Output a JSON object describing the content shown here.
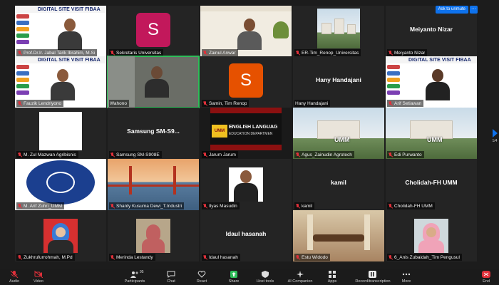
{
  "window": {
    "ask_to_unmute": "Ask to unmute",
    "more": "···",
    "page_indicator": "1/4"
  },
  "tiles": [
    {
      "name": "Prof.Dr.Ir. Jabal Tarik Ibrahim, M.Si",
      "slide_title": "DIGITAL SITE VISIT FIBAA"
    },
    {
      "name": "Sekretaris Universitas",
      "avatar": "S",
      "avatar_color": "#c2185b"
    },
    {
      "name": "Zainul Anwar"
    },
    {
      "name": "ER-Tim_Renop_Universitas"
    },
    {
      "name": "Meiyanto Nizar",
      "big": "Meiyanto Nizar"
    },
    {
      "name": "Fauzik Lendriyono",
      "slide_title": "DIGITAL SITE VISIT FIBAA"
    },
    {
      "name": "Wahono"
    },
    {
      "name": "Samin, Tim Renop",
      "avatar": "S",
      "avatar_color": "#e65100"
    },
    {
      "name": "Hany Handajani",
      "big": "Hany Handajani"
    },
    {
      "name": "Arif Setiawan",
      "slide_title": "DIGITAL SITE VISIT FIBAA"
    },
    {
      "name": "M. Zul Mazwan Agribisnis"
    },
    {
      "name": "Samsung SM-S908E",
      "big": "Samsung  SM-S9..."
    },
    {
      "name": "Jarum Jarum",
      "banner_line1": "ENGLISH LANGUAG",
      "banner_line2": "EDUCATION DEPARTMEN",
      "banner_logo": "UMM"
    },
    {
      "name": "Agus_Zainudin Agrotech",
      "sign": "UMM"
    },
    {
      "name": "Edi Purwanto",
      "sign": "UMM"
    },
    {
      "name": "M. Arif Zuhri_UMM"
    },
    {
      "name": "Shanty Kusuma Dewi_T.Industri"
    },
    {
      "name": "Ilyas Masudin"
    },
    {
      "name": "kamil",
      "big": "kamil"
    },
    {
      "name": "Cholidah-FH UMM",
      "big": "Cholidah-FH UMM"
    },
    {
      "name": "Zukhrufurrohmah, M.Pd"
    },
    {
      "name": "Merinda Lestandy"
    },
    {
      "name": "Idaul hasanah",
      "big": "Idaul hasanah"
    },
    {
      "name": "Estu Widodo"
    },
    {
      "name": "6_Anis Zubaidah_Tim Pengusul"
    }
  ],
  "controls": {
    "mic": "Audio",
    "video": "Video",
    "participants": "Participants",
    "participants_count": "95",
    "chat": "Chat",
    "react": "React",
    "share": "Share",
    "host_tools": "Host tools",
    "ai_companion": "AI Companion",
    "apps": "Apps",
    "record": "Record/transcription",
    "more": "More",
    "end": "End"
  },
  "colors": {
    "accent": "#0e72ed",
    "active_speaker": "#2ebd59",
    "end": "#e0303a"
  }
}
